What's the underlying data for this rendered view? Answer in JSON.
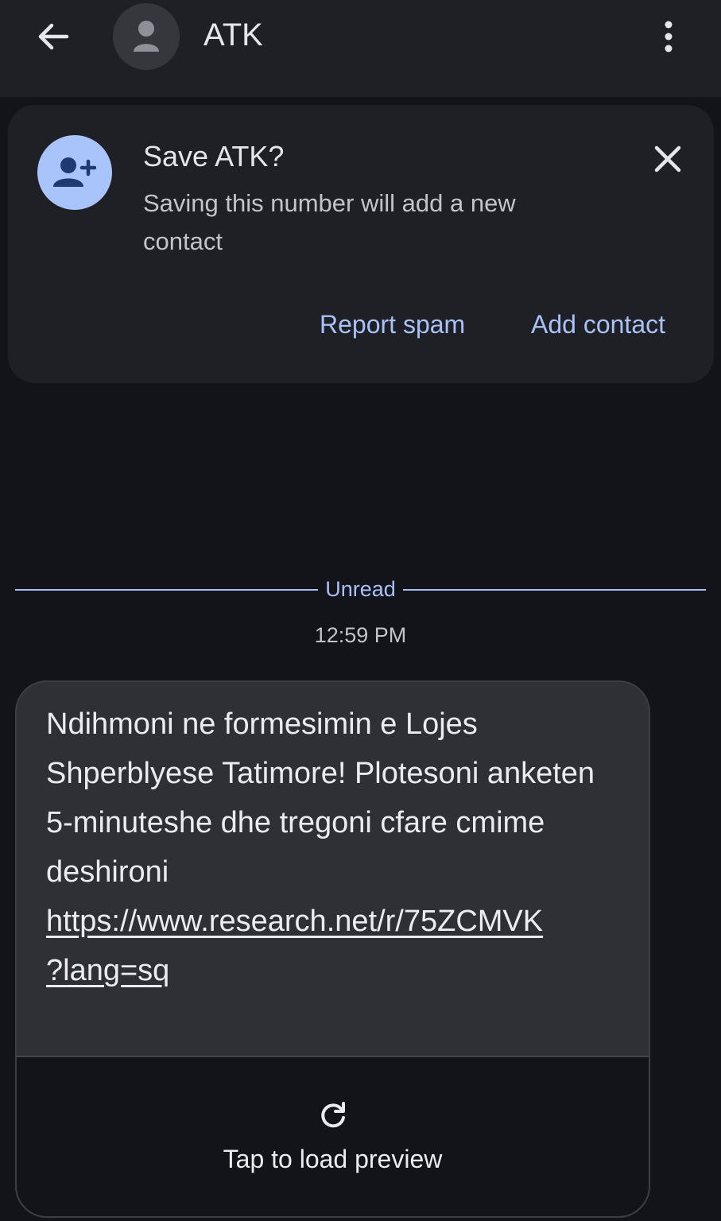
{
  "header": {
    "title": "ATK",
    "back_icon": "arrow-left-icon",
    "avatar_icon": "person-icon",
    "menu_icon": "more-vert-icon"
  },
  "save_card": {
    "title": "Save ATK?",
    "description": "Saving this number will add a new contact",
    "icon": "add-person-icon",
    "close_icon": "close-icon",
    "report_spam_label": "Report spam",
    "add_contact_label": "Add contact"
  },
  "divider": {
    "unread_label": "Unread"
  },
  "message": {
    "time": "12:59 PM",
    "text": "Ndihmoni ne formesimin e Lojes Shperblyese Tatimore! Plotesoni anketen 5-minuteshe dhe tregoni cfare cmime deshironi",
    "link_part1": "https://www.research.net/r/75ZCMVK",
    "link_part2": "?lang=sq",
    "preview_label": "Tap to load preview",
    "preview_icon": "refresh-icon"
  },
  "colors": {
    "background": "#121419",
    "accent": "#a8c2f7",
    "card": "#1e2026",
    "bubble": "#2f3036"
  }
}
